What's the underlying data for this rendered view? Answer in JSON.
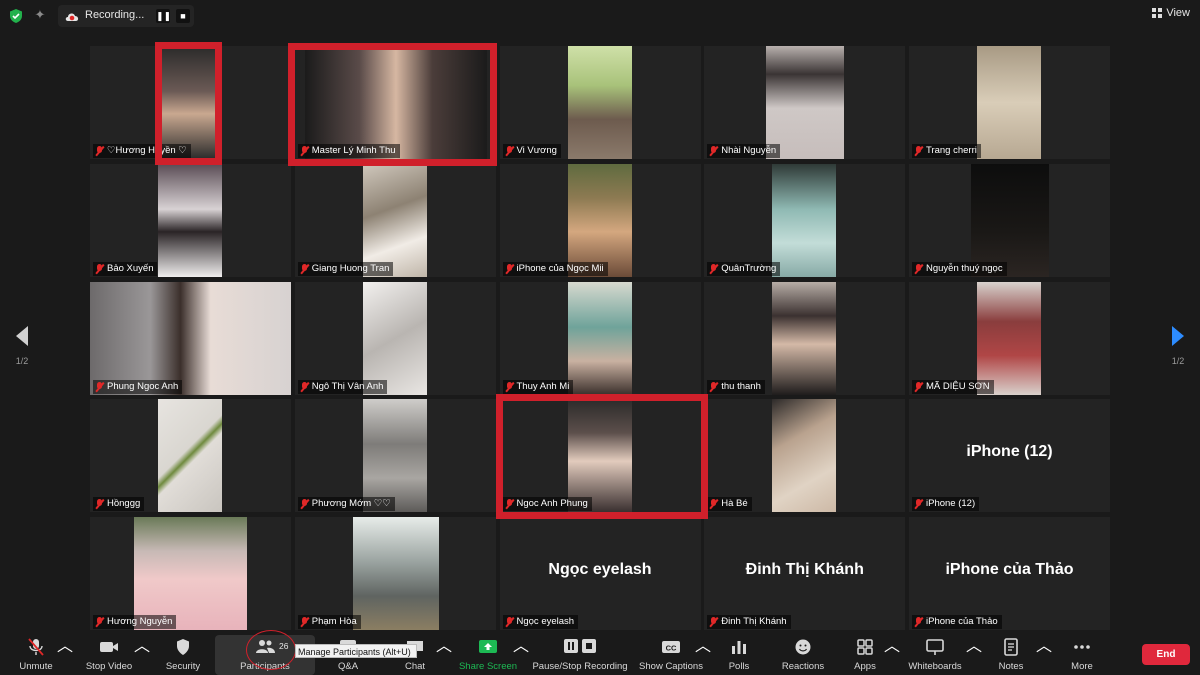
{
  "recording": {
    "label": "Recording..."
  },
  "view": {
    "label": "View"
  },
  "pages": {
    "indicator_left": "1/2",
    "indicator_right": "1/2"
  },
  "tiles": [
    {
      "name": "♡Hương Huyền ♡",
      "big": ""
    },
    {
      "name": "Master Lý Minh Thu",
      "big": ""
    },
    {
      "name": "Vi Vương",
      "big": ""
    },
    {
      "name": "Nhài Nguyễn",
      "big": ""
    },
    {
      "name": "Trang cherri",
      "big": ""
    },
    {
      "name": "Bảo Xuyến",
      "big": ""
    },
    {
      "name": "Giang Huong Tran",
      "big": ""
    },
    {
      "name": "iPhone của Ngọc Mii",
      "big": ""
    },
    {
      "name": "QuânTrường",
      "big": ""
    },
    {
      "name": "Nguyễn thuý ngọc",
      "big": ""
    },
    {
      "name": "Phung Ngoc Anh",
      "big": ""
    },
    {
      "name": "Ngô Thị Vân Anh",
      "big": ""
    },
    {
      "name": "Thuy Anh Mi",
      "big": ""
    },
    {
      "name": "thu thanh",
      "big": ""
    },
    {
      "name": "MÃ DIỆU SƠN",
      "big": ""
    },
    {
      "name": "Hồnggg",
      "big": ""
    },
    {
      "name": "Phương Mớm ♡♡",
      "big": ""
    },
    {
      "name": "Ngoc Anh Phung",
      "big": ""
    },
    {
      "name": "Hà Bé",
      "big": ""
    },
    {
      "name": "iPhone (12)",
      "big": "iPhone (12)"
    },
    {
      "name": "Hương Nguyễn",
      "big": ""
    },
    {
      "name": "Phạm Hòa",
      "big": ""
    },
    {
      "name": "Ngọc eyelash",
      "big": "Ngọc eyelash"
    },
    {
      "name": "Đinh Thị Khánh",
      "big": "Đinh Thị Khánh"
    },
    {
      "name": "iPhone của Thảo",
      "big": "iPhone của Thảo"
    }
  ],
  "toolbar": {
    "unmute": "Unmute",
    "stop_video": "Stop Video",
    "security": "Security",
    "participants": "Participants",
    "participants_count": "26",
    "qa": "Q&A",
    "chat": "Chat",
    "share_screen": "Share Screen",
    "pause_stop_recording": "Pause/Stop Recording",
    "show_captions": "Show Captions",
    "polls": "Polls",
    "reactions": "Reactions",
    "apps": "Apps",
    "whiteboards": "Whiteboards",
    "notes": "Notes",
    "more": "More",
    "end": "End",
    "tooltip": "Manage Participants (Alt+U)"
  },
  "colors": {
    "accent_blue": "#2d8cff",
    "highlight_red": "#d0202b",
    "end_red": "#e0283c",
    "share_green": "#1db954"
  }
}
